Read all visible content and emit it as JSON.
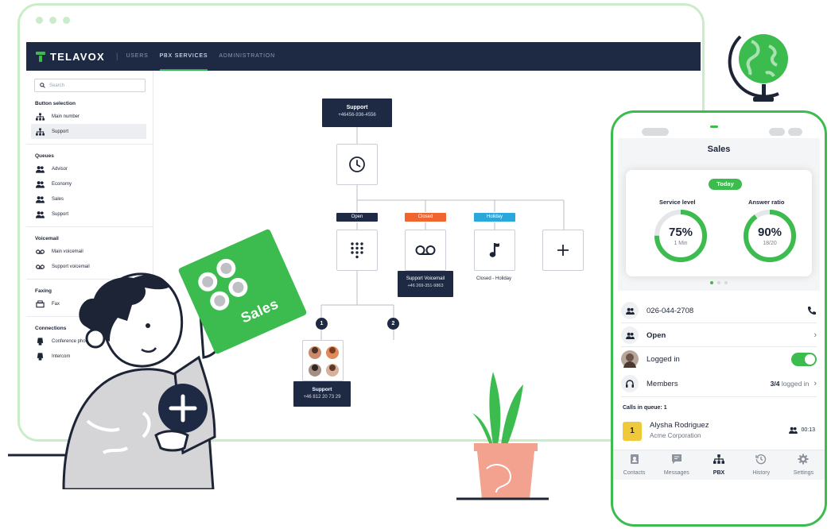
{
  "app": {
    "brand": "TELAVOX",
    "nav": [
      {
        "label": "USERS"
      },
      {
        "label": "PBX SERVICES"
      },
      {
        "label": "ADMINISTRATION"
      }
    ]
  },
  "sidebar": {
    "search_placeholder": "Search",
    "sections": [
      {
        "title": "Button selection",
        "items": [
          {
            "label": "Main number"
          },
          {
            "label": "Support"
          }
        ]
      },
      {
        "title": "Queues",
        "items": [
          {
            "label": "Advisor"
          },
          {
            "label": "Economy"
          },
          {
            "label": "Sales"
          },
          {
            "label": "Support"
          }
        ]
      },
      {
        "title": "Voicemail",
        "items": [
          {
            "label": "Main voicemail"
          },
          {
            "label": "Support voicemail"
          }
        ]
      },
      {
        "title": "Faxing",
        "items": [
          {
            "label": "Fax"
          }
        ]
      },
      {
        "title": "Connections",
        "items": [
          {
            "label": "Conference phone"
          },
          {
            "label": "Intercom"
          }
        ]
      }
    ]
  },
  "flow": {
    "root": {
      "title": "Support",
      "number": "+46456-936-4556"
    },
    "branches": [
      {
        "tag": "Open",
        "color": "#1e2a44"
      },
      {
        "tag": "Closed",
        "color": "#f0652f"
      },
      {
        "tag": "Holiday",
        "color": "#2aa8dc"
      }
    ],
    "voicemail_box": {
      "title": "Support Voicemail",
      "number": "+46 269-351-9863"
    },
    "holiday_caption": "Closed - Holiday",
    "options": [
      "1",
      "2"
    ],
    "support_box": {
      "title": "Support",
      "number": "+46 812 20 73 29"
    }
  },
  "illustration": {
    "card_label": "Sales"
  },
  "phone": {
    "title": "Sales",
    "today_label": "Today",
    "gauges": [
      {
        "label": "Service level",
        "value": "75%",
        "sub": "1 Min",
        "fraction": 0.75
      },
      {
        "label": "Answer ratio",
        "value": "90%",
        "sub": "18/20",
        "fraction": 0.9
      }
    ],
    "rows": {
      "number": "026-044-2708",
      "status": "Open",
      "logged_in": "Logged in",
      "members_label": "Members",
      "members_count": "3/4",
      "members_suffix": "logged in"
    },
    "queue_title": "Calls in queue: 1",
    "caller": {
      "position": "1",
      "name": "Alysha Rodriguez",
      "company": "Acme Corporation",
      "time": "00:13"
    },
    "tabs": [
      {
        "label": "Contacts",
        "icon": "contacts-icon"
      },
      {
        "label": "Messages",
        "icon": "messages-icon"
      },
      {
        "label": "PBX",
        "icon": "pbx-icon"
      },
      {
        "label": "History",
        "icon": "history-icon"
      },
      {
        "label": "Settings",
        "icon": "settings-icon"
      }
    ],
    "accent": "#3cbc4e"
  }
}
